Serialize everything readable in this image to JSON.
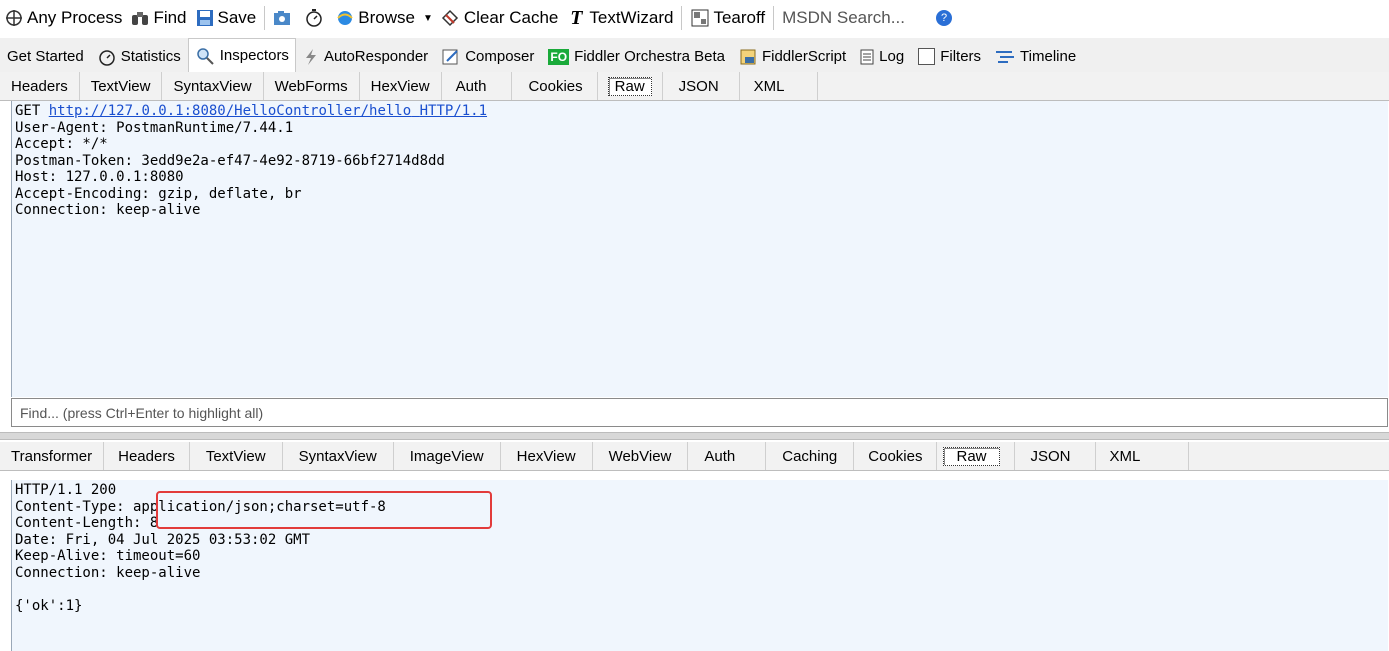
{
  "toolbar": {
    "any_process": "Any Process",
    "find": "Find",
    "save": "Save",
    "browse": "Browse",
    "clear_cache": "Clear Cache",
    "textwizard": "TextWizard",
    "tearoff": "Tearoff",
    "msdn_search": "MSDN Search..."
  },
  "main_tabs": [
    {
      "label": "Get Started"
    },
    {
      "label": "Statistics"
    },
    {
      "label": "Inspectors"
    },
    {
      "label": "AutoResponder"
    },
    {
      "label": "Composer"
    },
    {
      "label": "Fiddler Orchestra Beta",
      "badge": "FO"
    },
    {
      "label": "FiddlerScript"
    },
    {
      "label": "Log"
    },
    {
      "label": "Filters"
    },
    {
      "label": "Timeline"
    }
  ],
  "request_tabs": [
    "Headers",
    "TextView",
    "SyntaxView",
    "WebForms",
    "HexView",
    "Auth",
    "Cookies",
    "Raw",
    "JSON",
    "XML"
  ],
  "request": {
    "method": "GET",
    "url": "http://127.0.0.1:8080/HelloController/hello",
    "version": "HTTP/1.1",
    "lines": [
      "User-Agent: PostmanRuntime/7.44.1",
      "Accept: */*",
      "Postman-Token: 3edd9e2a-ef47-4e92-8719-66bf2714d8dd",
      "Host: 127.0.0.1:8080",
      "Accept-Encoding: gzip, deflate, br",
      "Connection: keep-alive"
    ]
  },
  "find_placeholder": "Find... (press Ctrl+Enter to highlight all)",
  "response_tabs": [
    "Transformer",
    "Headers",
    "TextView",
    "SyntaxView",
    "ImageView",
    "HexView",
    "WebView",
    "Auth",
    "Caching",
    "Cookies",
    "Raw",
    "JSON",
    "XML"
  ],
  "response": {
    "lines": [
      "HTTP/1.1 200",
      "Content-Type: application/json;charset=utf-8",
      "Content-Length: 8",
      "Date: Fri, 04 Jul 2025 03:53:02 GMT",
      "Keep-Alive: timeout=60",
      "Connection: keep-alive",
      "",
      "{'ok':1}"
    ]
  },
  "colors": {
    "highlight_border": "#e23b3b",
    "text_pane_bg": "#f0f6fd",
    "link": "#1a4fcf"
  }
}
